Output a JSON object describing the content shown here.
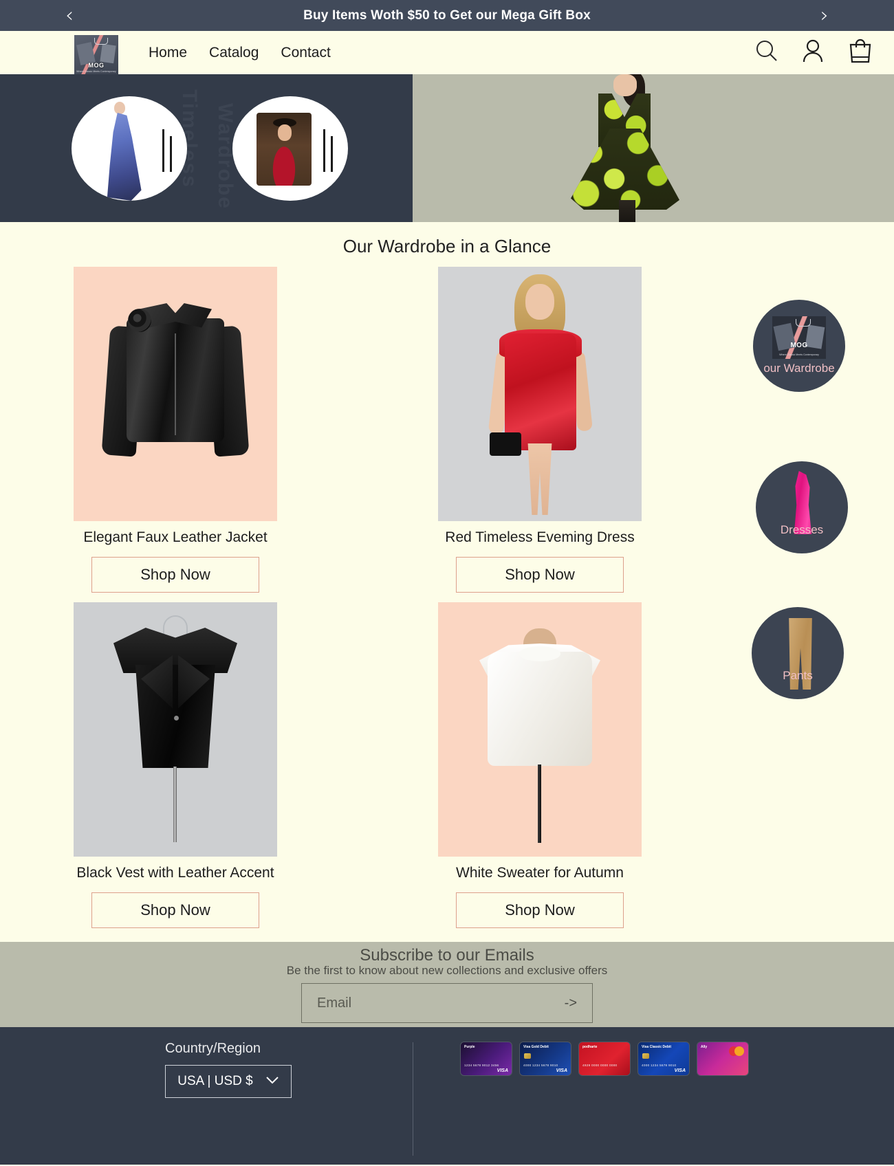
{
  "announcement": {
    "text": "Buy Items Woth $50 to Get our Mega Gift Box",
    "prev_icon": "chevron-left",
    "next_icon": "chevron-right"
  },
  "nav": {
    "logo": {
      "name": "MOG",
      "tagline": "Where Classic Meets Contemporary"
    },
    "links": [
      {
        "label": "Home"
      },
      {
        "label": "Catalog"
      },
      {
        "label": "Contact"
      }
    ],
    "icons": [
      {
        "name": "search-icon"
      },
      {
        "name": "account-icon"
      },
      {
        "name": "cart-icon"
      }
    ]
  },
  "hero": {
    "ghost_text_1": "Timeless",
    "ghost_text_2": "Wardrobe"
  },
  "section": {
    "title": "Our Wardrobe in a Glance"
  },
  "products": [
    {
      "title": "Elegant Faux Leather Jacket",
      "cta": "Shop Now",
      "bg": "#fbd6c2"
    },
    {
      "title": "Red Timeless Eveming Dress",
      "cta": "Shop Now",
      "bg": "#d2d3d5"
    },
    {
      "title": "Black Vest with Leather Accent",
      "cta": "Shop Now",
      "bg": "#cdcfd1"
    },
    {
      "title": "White Sweater for Autumn",
      "cta": "Shop Now",
      "bg": "#fbd6c2"
    }
  ],
  "categories": [
    {
      "label": "our Wardrobe"
    },
    {
      "label": "Dresses"
    },
    {
      "label": "Pants"
    }
  ],
  "newsletter": {
    "title": "Subscribe to our Emails",
    "subtitle": "Be the first to know about new collections and exclusive offers",
    "placeholder": "Email",
    "value": "",
    "submit_label": "->"
  },
  "footer": {
    "country_label": "Country/Region",
    "country_value": "USA | USD $",
    "chevron": "chevron-down",
    "payment_cards": [
      {
        "brand": "Purple",
        "number": "1234 5678 9012 3456",
        "network": "VISA"
      },
      {
        "brand": "Visa Gold Debit",
        "number": "4000 1234 5678 9010",
        "network": "VISA"
      },
      {
        "brand": "podharte",
        "number": "4929 0000 0000 0000",
        "network": ""
      },
      {
        "brand": "Visa Classic Debit",
        "number": "4000 1234 5678 9010",
        "network": "VISA"
      },
      {
        "brand": "Ally",
        "number": "",
        "network": ""
      }
    ]
  },
  "colors": {
    "dark": "#333b49",
    "cream": "#fdfde8",
    "sage": "#b9bbab",
    "accent": "#dda08c",
    "pink_label": "#f0bfc4"
  }
}
